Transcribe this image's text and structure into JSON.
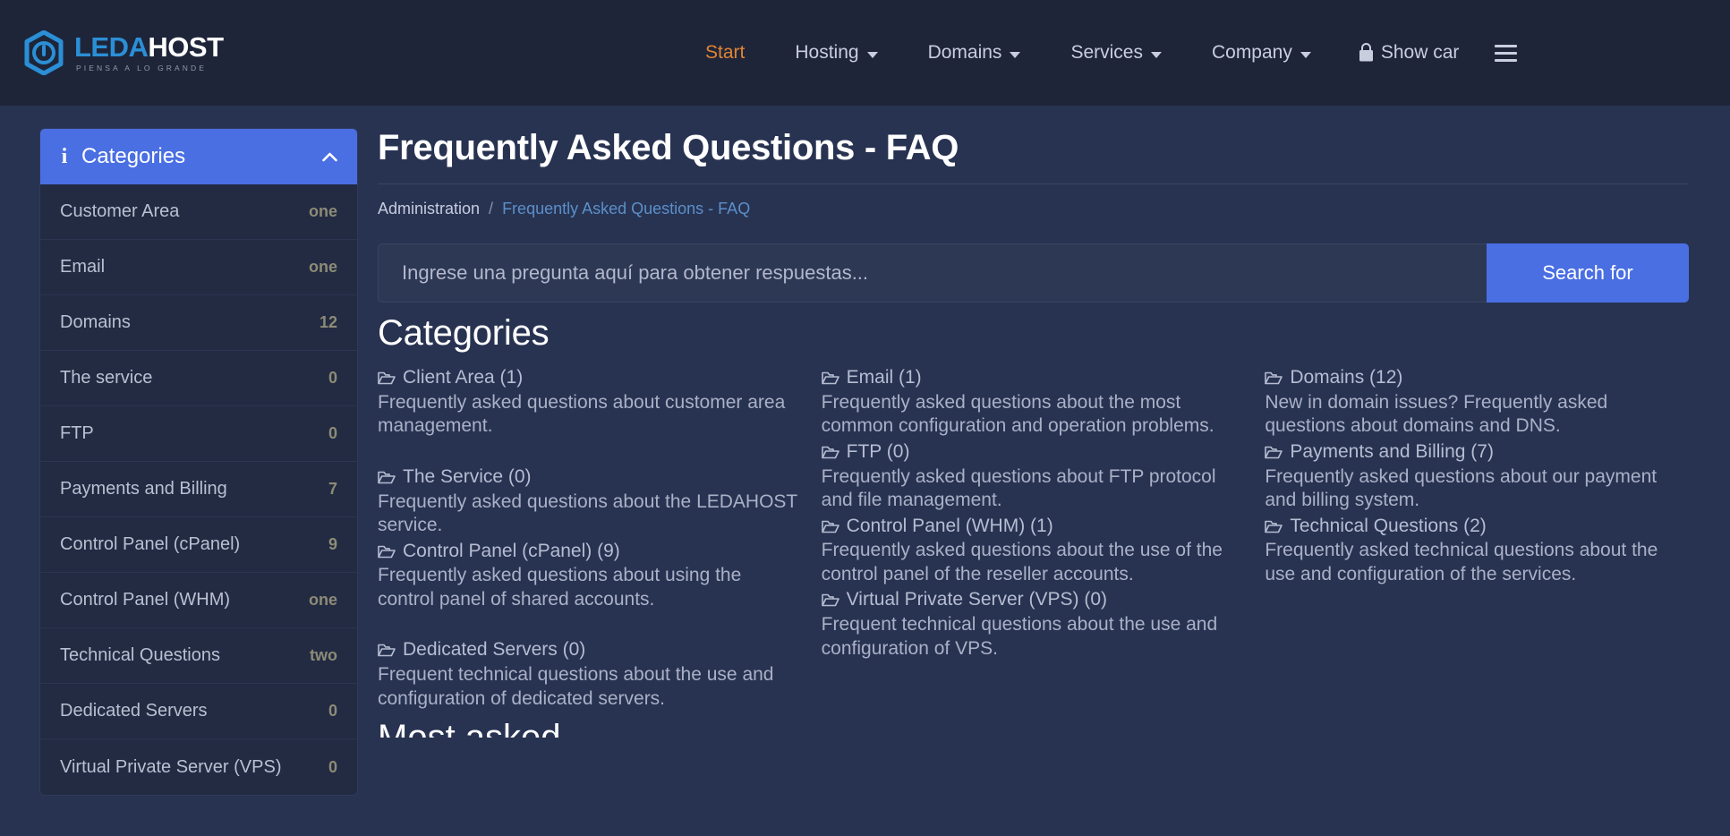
{
  "header": {
    "logo": {
      "part1": "LEDA",
      "part2": "HOST",
      "tagline": "PIENSA A LO GRANDE",
      "mark_color": "#2b8fd6"
    },
    "nav": [
      {
        "label": "Start",
        "has_caret": false,
        "active": true
      },
      {
        "label": "Hosting",
        "has_caret": true,
        "active": false
      },
      {
        "label": "Domains",
        "has_caret": true,
        "active": false
      },
      {
        "label": "Services",
        "has_caret": true,
        "active": false
      },
      {
        "label": "Company",
        "has_caret": true,
        "active": false
      }
    ],
    "cart_label": "Show car",
    "active_color": "#e08434"
  },
  "sidebar": {
    "panel_title": "Categories",
    "items": [
      {
        "label": "Customer Area",
        "count": "one"
      },
      {
        "label": "Email",
        "count": "one"
      },
      {
        "label": "Domains",
        "count": "12"
      },
      {
        "label": "The service",
        "count": "0"
      },
      {
        "label": "FTP",
        "count": "0"
      },
      {
        "label": "Payments and Billing",
        "count": "7"
      },
      {
        "label": "Control Panel (cPanel)",
        "count": "9"
      },
      {
        "label": "Control Panel (WHM)",
        "count": "one"
      },
      {
        "label": "Technical Questions",
        "count": "two"
      },
      {
        "label": "Dedicated Servers",
        "count": "0"
      },
      {
        "label": "Virtual Private Server (VPS)",
        "count": "0"
      }
    ],
    "accent_color": "#4a6fe3"
  },
  "main": {
    "title": "Frequently Asked Questions - FAQ",
    "breadcrumb": {
      "root": "Administration",
      "separator": "/",
      "current": "Frequently Asked Questions - FAQ"
    },
    "search": {
      "placeholder": "Ingrese una pregunta aquí para obtener respuestas...",
      "value": "",
      "button_label": "Search for"
    },
    "section_title": "Categories",
    "columns": [
      {
        "entries": [
          {
            "link": "Client Area (1)",
            "desc": "Frequently asked questions about customer area management.",
            "gap_after": true
          },
          {
            "link": "The Service (0)",
            "desc": "Frequently asked questions about the LEDAHOST service.",
            "gap_after": false
          },
          {
            "link": "Control Panel (cPanel) (9)",
            "desc": "Frequently asked questions about using the control panel of shared accounts.",
            "gap_after": true
          },
          {
            "link": "Dedicated Servers (0)",
            "desc": "Frequent technical questions about the use and configuration of dedicated servers.",
            "gap_after": false
          }
        ]
      },
      {
        "entries": [
          {
            "link": "Email (1)",
            "desc": "Frequently asked questions about the most common configuration and operation problems.",
            "gap_after": false
          },
          {
            "link": "FTP (0)",
            "desc": "Frequently asked questions about FTP protocol and file management.",
            "gap_after": false
          },
          {
            "link": "Control Panel (WHM) (1)",
            "desc": "Frequently asked questions about the use of the control panel of the reseller accounts.",
            "gap_after": false
          },
          {
            "link": "Virtual Private Server (VPS) (0)",
            "desc": "Frequent technical questions about the use and configuration of VPS.",
            "gap_after": false
          }
        ]
      },
      {
        "entries": [
          {
            "link": "Domains (12)",
            "desc": "New in domain issues? Frequently asked questions about domains and DNS.",
            "gap_after": false
          },
          {
            "link": "Payments and Billing (7)",
            "desc": "Frequently asked questions about our payment and billing system.",
            "gap_after": false
          },
          {
            "link": "Technical Questions (2)",
            "desc": "Frequently asked technical questions about the use and configuration of the services.",
            "gap_after": false
          }
        ]
      }
    ],
    "next_section_title": "Most asked"
  }
}
